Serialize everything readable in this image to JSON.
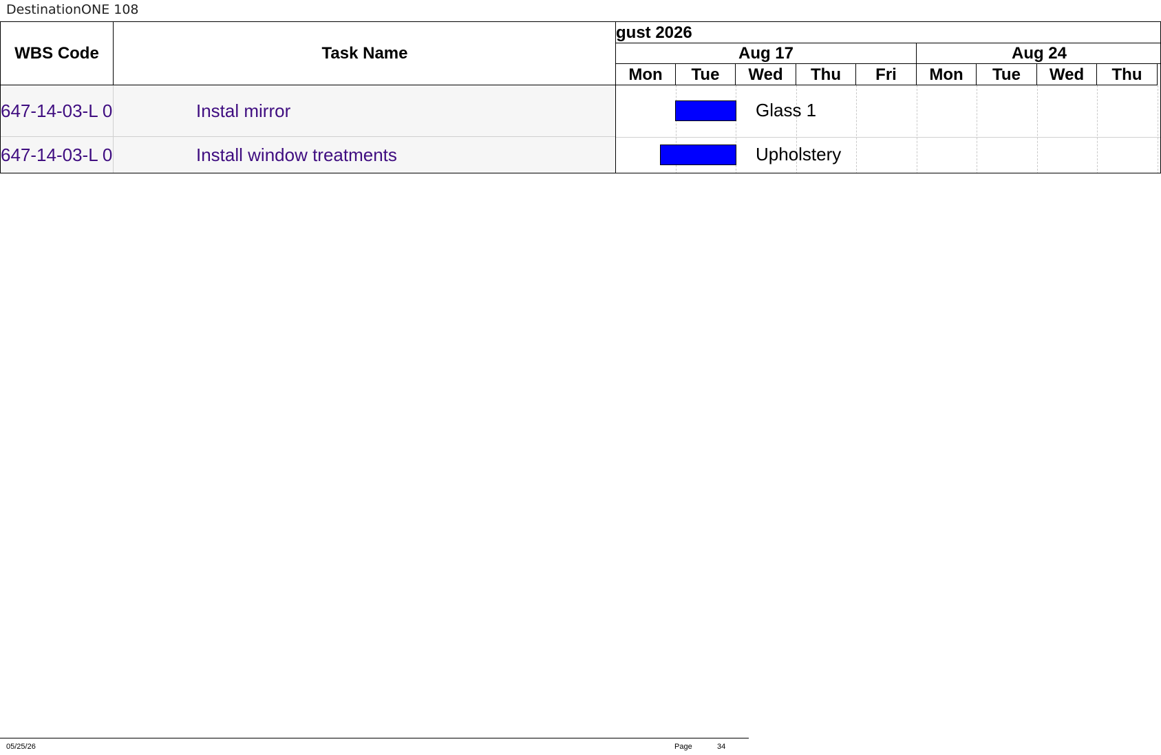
{
  "document": {
    "title": "DestinationONE 108"
  },
  "table": {
    "headers": {
      "wbs": "WBS Code",
      "task": "Task Name"
    },
    "rows": [
      {
        "wbs": "647-14-03-L 0",
        "task": "Instal mirror",
        "bar_label": "Glass 1"
      },
      {
        "wbs": "647-14-03-L 0",
        "task": "Install window treatments",
        "bar_label": "Upholstery"
      }
    ]
  },
  "timeline": {
    "month": "gust 2026",
    "weeks": [
      "Aug 17",
      "Aug 24"
    ],
    "days": [
      "Mon",
      "Tue",
      "Wed",
      "Thu",
      "Fri",
      "Mon",
      "Tue",
      "Wed",
      "Thu"
    ]
  },
  "colors": {
    "bar": "#0000ff",
    "task_text": "#3f0d80"
  },
  "footer": {
    "date": "05/25/26",
    "page_label": "Page",
    "page_number": "34"
  }
}
